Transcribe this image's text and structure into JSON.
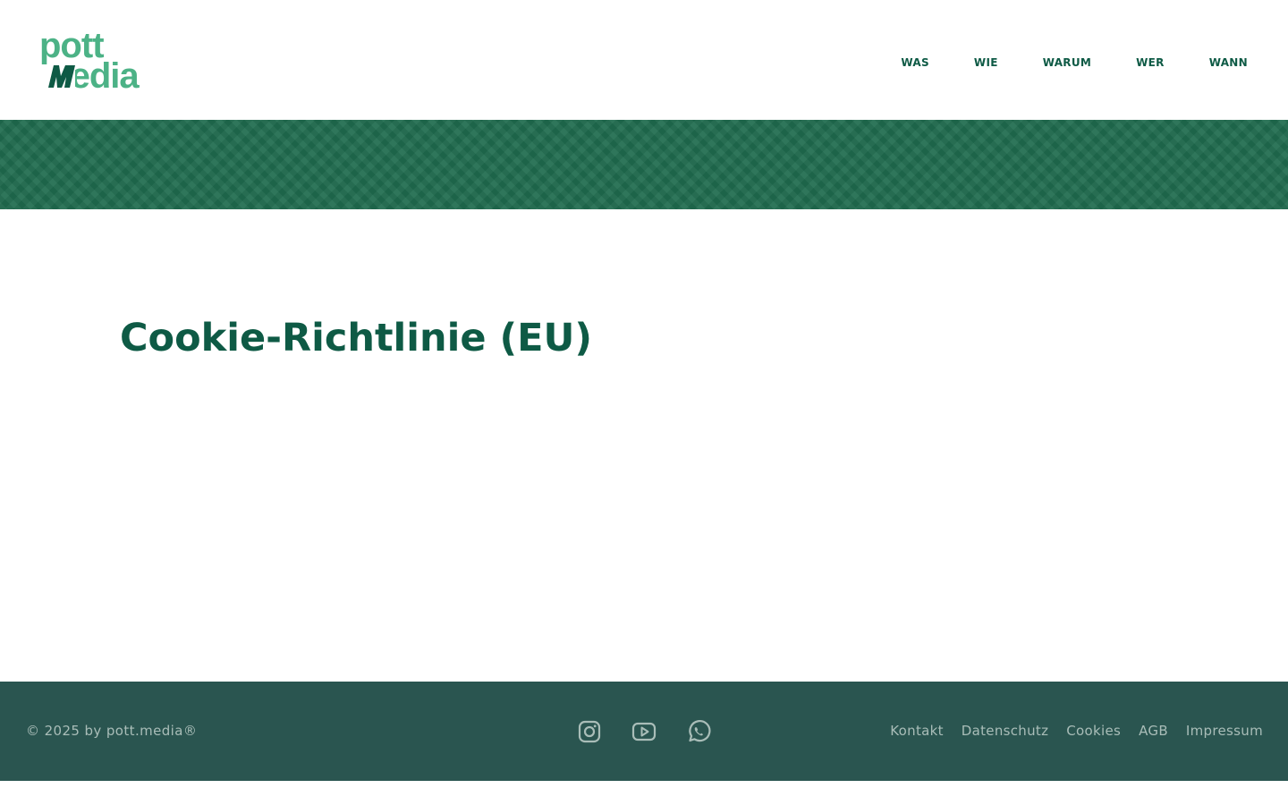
{
  "header": {
    "logo": {
      "top": "pott",
      "bottom": "media"
    },
    "nav": [
      {
        "label": "WAS"
      },
      {
        "label": "WIE"
      },
      {
        "label": "WARUM"
      },
      {
        "label": "WER"
      },
      {
        "label": "WANN"
      }
    ]
  },
  "main": {
    "title": "Cookie-Richtlinie (EU)"
  },
  "footer": {
    "copyright": "© 2025 by pott.media®",
    "social": [
      {
        "icon": "instagram-icon"
      },
      {
        "icon": "youtube-icon"
      },
      {
        "icon": "whatsapp-icon"
      }
    ],
    "links": [
      {
        "label": "Kontakt"
      },
      {
        "label": "Datenschutz"
      },
      {
        "label": "Cookies"
      },
      {
        "label": "AGB"
      },
      {
        "label": "Impressum"
      }
    ]
  },
  "colors": {
    "brand_light": "#4cb286",
    "brand_dark": "#0e5a45",
    "banner": "#1f6b4e",
    "footer_bg": "#2a5550",
    "footer_text": "#a9bdb8"
  }
}
